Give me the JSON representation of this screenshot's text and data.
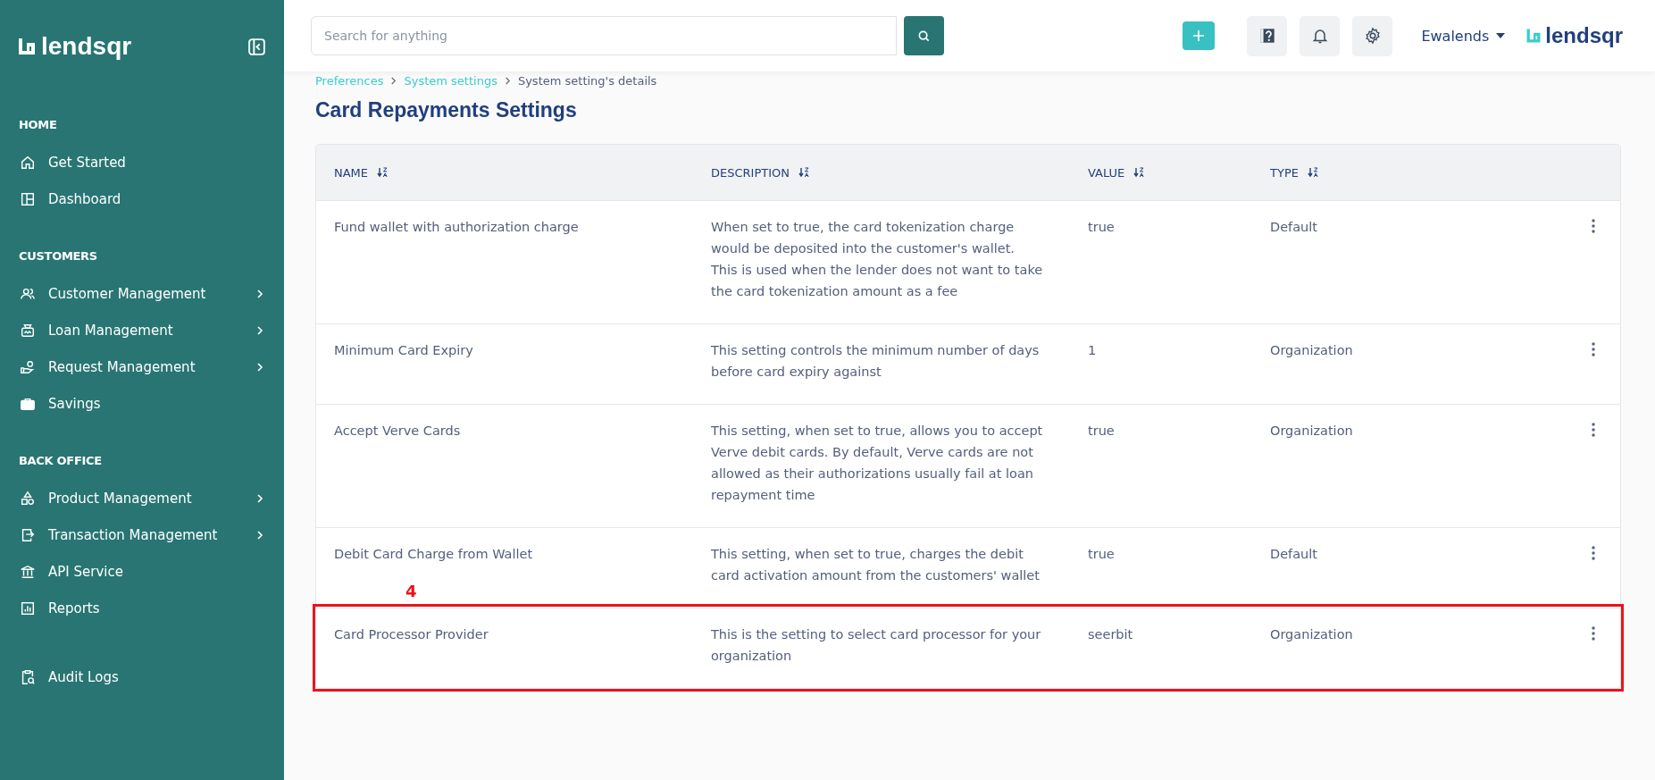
{
  "sidebar": {
    "logo": "lendsqr",
    "sections": [
      {
        "heading": "HOME",
        "items": [
          {
            "label": "Get Started",
            "expandable": false
          },
          {
            "label": "Dashboard",
            "expandable": false
          }
        ]
      },
      {
        "heading": "CUSTOMERS",
        "items": [
          {
            "label": "Customer Management",
            "expandable": true
          },
          {
            "label": "Loan Management",
            "expandable": true
          },
          {
            "label": "Request Management",
            "expandable": true
          },
          {
            "label": "Savings",
            "expandable": false
          }
        ]
      },
      {
        "heading": "BACK OFFICE",
        "items": [
          {
            "label": "Product Management",
            "expandable": true
          },
          {
            "label": "Transaction Management",
            "expandable": true
          },
          {
            "label": "API Service",
            "expandable": false
          },
          {
            "label": "Reports",
            "expandable": false
          }
        ]
      },
      {
        "items": [
          {
            "label": "Audit Logs",
            "expandable": false
          }
        ]
      }
    ]
  },
  "topbar": {
    "search": {
      "placeholder": "Search for anything"
    },
    "user": "Ewalends",
    "logo": "lendsqr"
  },
  "breadcrumb": [
    "Preferences",
    "System settings",
    "System setting's details"
  ],
  "page_title": "Card Repayments Settings",
  "table": {
    "columns": [
      "NAME",
      "DESCRIPTION",
      "VALUE",
      "TYPE"
    ],
    "rows": [
      {
        "name": "Fund wallet with authorization charge",
        "description": "When set to true, the card tokenization charge would be deposited into the customer's wallet. This is used when the lender does not want to take the card tokenization amount as a fee",
        "value": "true",
        "type": "Default",
        "highlighted": false
      },
      {
        "name": "Minimum Card Expiry",
        "description": "This setting controls the minimum number of days before card expiry against",
        "value": "1",
        "type": "Organization",
        "highlighted": false
      },
      {
        "name": "Accept Verve Cards",
        "description": "This setting, when set to true, allows you to accept Verve debit cards. By default, Verve cards are not allowed as their authorizations usually fail at loan repayment time",
        "value": "true",
        "type": "Organization",
        "highlighted": false
      },
      {
        "name": "Debit Card Charge from Wallet",
        "description": "This setting, when set to true, charges the debit card activation amount from the customers' wallet",
        "value": "true",
        "type": "Default",
        "highlighted": false
      },
      {
        "name": "Card Processor Provider",
        "description": "This is the setting to select card processor for your organization",
        "value": "seerbit",
        "type": "Organization",
        "highlighted": true,
        "annotation": "4"
      }
    ]
  }
}
